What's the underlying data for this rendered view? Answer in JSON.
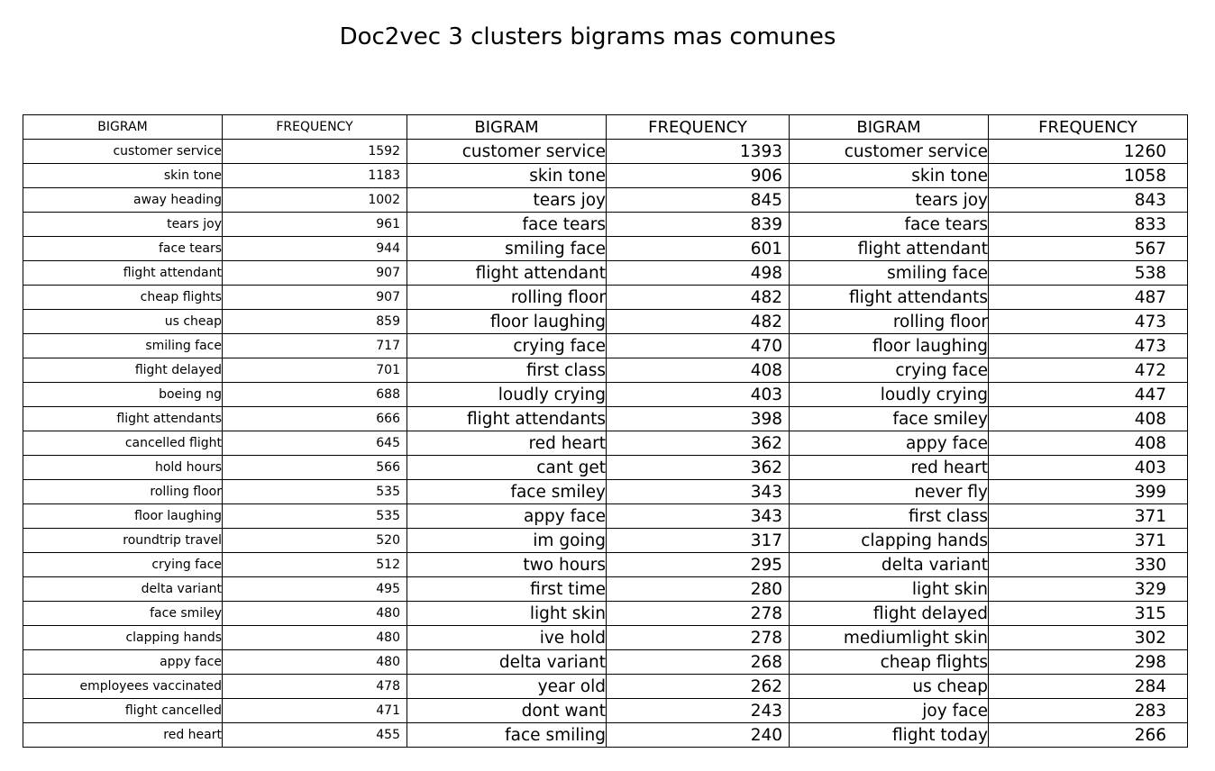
{
  "chart_data": {
    "type": "table",
    "title": "Doc2vec 3 clusters bigrams mas comunes",
    "columns": [
      "BIGRAM",
      "FREQUENCY",
      "BIGRAM",
      "FREQUENCY",
      "BIGRAM",
      "FREQUENCY"
    ],
    "rows": [
      [
        "customer service",
        "1592",
        "customer service",
        "1393",
        "customer service",
        "1260"
      ],
      [
        "skin tone",
        "1183",
        "skin tone",
        "906",
        "skin tone",
        "1058"
      ],
      [
        "away heading",
        "1002",
        "tears joy",
        "845",
        "tears joy",
        "843"
      ],
      [
        "tears joy",
        "961",
        "face tears",
        "839",
        "face tears",
        "833"
      ],
      [
        "face tears",
        "944",
        "smiling face",
        "601",
        "flight attendant",
        "567"
      ],
      [
        "flight attendant",
        "907",
        "flight attendant",
        "498",
        "smiling face",
        "538"
      ],
      [
        "cheap flights",
        "907",
        "rolling floor",
        "482",
        "flight attendants",
        "487"
      ],
      [
        "us cheap",
        "859",
        "floor laughing",
        "482",
        "rolling floor",
        "473"
      ],
      [
        "smiling face",
        "717",
        "crying face",
        "470",
        "floor laughing",
        "473"
      ],
      [
        "flight delayed",
        "701",
        "first class",
        "408",
        "crying face",
        "472"
      ],
      [
        "boeing ng",
        "688",
        "loudly crying",
        "403",
        "loudly crying",
        "447"
      ],
      [
        "flight attendants",
        "666",
        "flight attendants",
        "398",
        "face smiley",
        "408"
      ],
      [
        "cancelled flight",
        "645",
        "red heart",
        "362",
        "appy face",
        "408"
      ],
      [
        "hold hours",
        "566",
        "cant get",
        "362",
        "red heart",
        "403"
      ],
      [
        "rolling floor",
        "535",
        "face smiley",
        "343",
        "never fly",
        "399"
      ],
      [
        "floor laughing",
        "535",
        "appy face",
        "343",
        "first class",
        "371"
      ],
      [
        "roundtrip travel",
        "520",
        "im going",
        "317",
        "clapping hands",
        "371"
      ],
      [
        "crying face",
        "512",
        "two hours",
        "295",
        "delta variant",
        "330"
      ],
      [
        "delta variant",
        "495",
        "first time",
        "280",
        "light skin",
        "329"
      ],
      [
        "face smiley",
        "480",
        "light skin",
        "278",
        "flight delayed",
        "315"
      ],
      [
        "clapping hands",
        "480",
        "ive hold",
        "278",
        "mediumlight skin",
        "302"
      ],
      [
        "appy face",
        "480",
        "delta variant",
        "268",
        "cheap flights",
        "298"
      ],
      [
        "employees vaccinated",
        "478",
        "year old",
        "262",
        "us cheap",
        "284"
      ],
      [
        "flight cancelled",
        "471",
        "dont want",
        "243",
        "joy face",
        "283"
      ],
      [
        "red heart",
        "455",
        "face smiling",
        "240",
        "flight today",
        "266"
      ]
    ]
  }
}
